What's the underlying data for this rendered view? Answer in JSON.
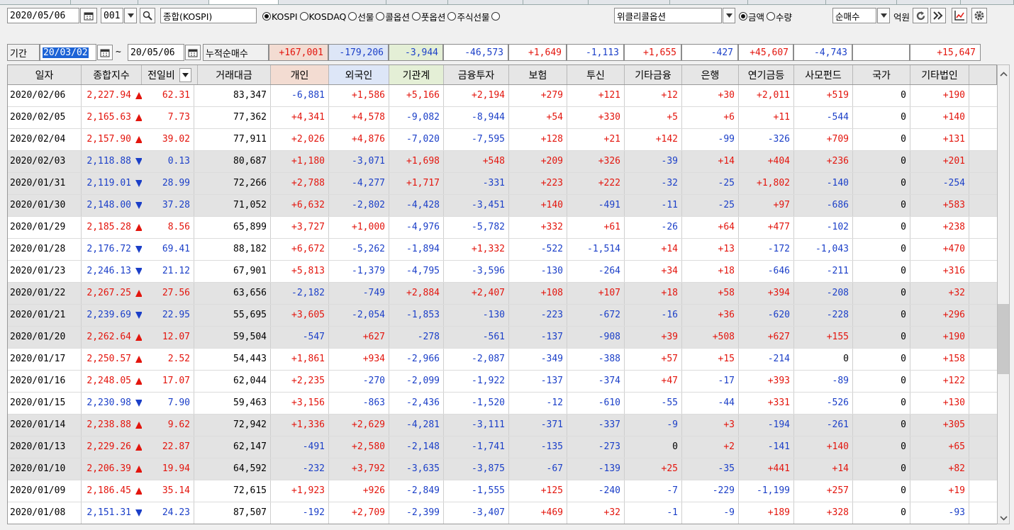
{
  "toolbar": {
    "date": "2020/05/06",
    "code": "001",
    "index_name": "종합(KOSPI)",
    "markets": [
      {
        "label": "KOSPI",
        "selected": true
      },
      {
        "label": "KOSDAQ",
        "selected": false
      },
      {
        "label": "선물",
        "selected": false
      },
      {
        "label": "콜옵션",
        "selected": false
      },
      {
        "label": "풋옵션",
        "selected": false
      },
      {
        "label": "주식선물",
        "selected": false
      }
    ],
    "option_select": "위클리콜옵션",
    "units": [
      {
        "label": "금액",
        "selected": true
      },
      {
        "label": "수량",
        "selected": false
      }
    ],
    "type_select": "순매수",
    "unit_label": "억원"
  },
  "period": {
    "label": "기간",
    "from": "20/03/02",
    "tilde": "~",
    "to": "20/05/06",
    "cum_label": "누적순매수"
  },
  "summary": [
    "+167,001",
    "-179,206",
    "-3,944",
    "-46,573",
    "+1,649",
    "-1,113",
    "+1,655",
    "-427",
    "+45,607",
    "-4,743",
    "",
    "+15,647"
  ],
  "columns": [
    "일자",
    "종합지수",
    "전일비",
    "거래대금",
    "개인",
    "외국인",
    "기관계",
    "금융투자",
    "보험",
    "투신",
    "기타금융",
    "은행",
    "연기금등",
    "사모펀드",
    "국가",
    "기타법인"
  ],
  "rows": [
    [
      "2020/02/06",
      "2,227.94",
      "up",
      "62.31",
      "83,347",
      "-6,881",
      "+1,586",
      "+5,166",
      "+2,194",
      "+279",
      "+121",
      "+12",
      "+30",
      "+2,011",
      "+519",
      "0",
      "+190"
    ],
    [
      "2020/02/05",
      "2,165.63",
      "up",
      "7.73",
      "77,362",
      "+4,341",
      "+4,578",
      "-9,082",
      "-8,944",
      "+54",
      "+330",
      "+5",
      "+6",
      "+11",
      "-544",
      "0",
      "+140"
    ],
    [
      "2020/02/04",
      "2,157.90",
      "up",
      "39.02",
      "77,911",
      "+2,026",
      "+4,876",
      "-7,020",
      "-7,595",
      "+128",
      "+21",
      "+142",
      "-99",
      "-326",
      "+709",
      "0",
      "+131"
    ],
    [
      "2020/02/03",
      "2,118.88",
      "down",
      "0.13",
      "80,687",
      "+1,180",
      "-3,071",
      "+1,698",
      "+548",
      "+209",
      "+326",
      "-39",
      "+14",
      "+404",
      "+236",
      "0",
      "+201"
    ],
    [
      "2020/01/31",
      "2,119.01",
      "down",
      "28.99",
      "72,266",
      "+2,788",
      "-4,277",
      "+1,717",
      "-331",
      "+223",
      "+222",
      "-32",
      "-25",
      "+1,802",
      "-140",
      "0",
      "-254"
    ],
    [
      "2020/01/30",
      "2,148.00",
      "down",
      "37.28",
      "71,052",
      "+6,632",
      "-2,802",
      "-4,428",
      "-3,451",
      "+140",
      "-491",
      "-11",
      "-25",
      "+97",
      "-686",
      "0",
      "+583"
    ],
    [
      "2020/01/29",
      "2,185.28",
      "up",
      "8.56",
      "65,899",
      "+3,727",
      "+1,000",
      "-4,976",
      "-5,782",
      "+332",
      "+61",
      "-26",
      "+64",
      "+477",
      "-102",
      "0",
      "+238"
    ],
    [
      "2020/01/28",
      "2,176.72",
      "down",
      "69.41",
      "88,182",
      "+6,672",
      "-5,262",
      "-1,894",
      "+1,332",
      "-522",
      "-1,514",
      "+14",
      "+13",
      "-172",
      "-1,043",
      "0",
      "+470"
    ],
    [
      "2020/01/23",
      "2,246.13",
      "down",
      "21.12",
      "67,901",
      "+5,813",
      "-1,379",
      "-4,795",
      "-3,596",
      "-130",
      "-264",
      "+34",
      "+18",
      "-646",
      "-211",
      "0",
      "+316"
    ],
    [
      "2020/01/22",
      "2,267.25",
      "up",
      "27.56",
      "63,656",
      "-2,182",
      "-749",
      "+2,884",
      "+2,407",
      "+108",
      "+107",
      "+18",
      "+58",
      "+394",
      "-208",
      "0",
      "+32"
    ],
    [
      "2020/01/21",
      "2,239.69",
      "down",
      "22.95",
      "55,695",
      "+3,605",
      "-2,054",
      "-1,853",
      "-130",
      "-223",
      "-672",
      "-16",
      "+36",
      "-620",
      "-228",
      "0",
      "+296"
    ],
    [
      "2020/01/20",
      "2,262.64",
      "up",
      "12.07",
      "59,504",
      "-547",
      "+627",
      "-278",
      "-561",
      "-137",
      "-908",
      "+39",
      "+508",
      "+627",
      "+155",
      "0",
      "+190"
    ],
    [
      "2020/01/17",
      "2,250.57",
      "up",
      "2.52",
      "54,443",
      "+1,861",
      "+934",
      "-2,966",
      "-2,087",
      "-349",
      "-388",
      "+57",
      "+15",
      "-214",
      "0",
      "0",
      "+158"
    ],
    [
      "2020/01/16",
      "2,248.05",
      "up",
      "17.07",
      "62,044",
      "+2,235",
      "-270",
      "-2,099",
      "-1,922",
      "-137",
      "-374",
      "+47",
      "-17",
      "+393",
      "-89",
      "0",
      "+122"
    ],
    [
      "2020/01/15",
      "2,230.98",
      "down",
      "7.90",
      "59,463",
      "+3,156",
      "-863",
      "-2,436",
      "-1,520",
      "-12",
      "-610",
      "-55",
      "-44",
      "+331",
      "-526",
      "0",
      "+130"
    ],
    [
      "2020/01/14",
      "2,238.88",
      "up",
      "9.62",
      "72,942",
      "+1,336",
      "+2,629",
      "-4,281",
      "-3,111",
      "-371",
      "-337",
      "-9",
      "+3",
      "-194",
      "-261",
      "0",
      "+305"
    ],
    [
      "2020/01/13",
      "2,229.26",
      "up",
      "22.87",
      "62,147",
      "-491",
      "+2,580",
      "-2,148",
      "-1,741",
      "-135",
      "-273",
      "0",
      "+2",
      "-141",
      "+140",
      "0",
      "+65"
    ],
    [
      "2020/01/10",
      "2,206.39",
      "up",
      "19.94",
      "64,592",
      "-232",
      "+3,792",
      "-3,635",
      "-3,875",
      "-67",
      "-139",
      "+25",
      "-35",
      "+441",
      "+14",
      "0",
      "+82"
    ],
    [
      "2020/01/09",
      "2,186.45",
      "up",
      "35.14",
      "72,615",
      "+1,923",
      "+926",
      "-2,849",
      "-1,555",
      "+125",
      "-240",
      "-7",
      "-229",
      "-1,199",
      "+257",
      "0",
      "+19"
    ],
    [
      "2020/01/08",
      "2,151.31",
      "down",
      "24.23",
      "87,507",
      "-192",
      "+2,709",
      "-2,399",
      "-3,407",
      "+469",
      "+32",
      "-1",
      "-9",
      "+189",
      "+328",
      "0",
      "-93"
    ]
  ],
  "colors": {
    "up": "#e3150d",
    "down": "#1b3fc8",
    "personal_header": "#f3dcd2",
    "foreign_header": "#dde6f7",
    "inst_header": "#e4efd6",
    "selection": "#1c63d6"
  }
}
